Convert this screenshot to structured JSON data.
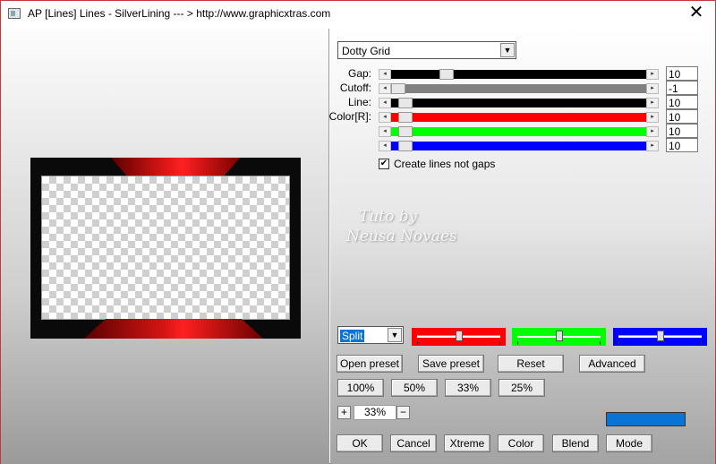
{
  "window": {
    "title": "AP [Lines]  Lines - SilverLining     --- > http://www.graphicxtras.com",
    "close_glyph": "✕"
  },
  "preset_dropdown": {
    "value": "Dotty Grid",
    "arrow": "▼"
  },
  "sliders": [
    {
      "label": "Gap:",
      "value": "10",
      "position": 0.2,
      "track_color": "#000000"
    },
    {
      "label": "Cutoff:",
      "value": "-1",
      "position": 0.0,
      "track_color": "#808080"
    },
    {
      "label": "Line:",
      "value": "10",
      "position": 0.03,
      "track_color": "#000000"
    },
    {
      "label": "Color[R]:",
      "value": "10",
      "position": 0.03,
      "track_color": "#ff0000"
    },
    {
      "label": "",
      "value": "10",
      "position": 0.03,
      "track_color": "#00ff00"
    },
    {
      "label": "",
      "value": "10",
      "position": 0.03,
      "track_color": "#0000ff"
    }
  ],
  "scroll_glyphs": {
    "left": "◂",
    "right": "▸"
  },
  "create_lines": {
    "label": "Create lines not gaps",
    "checked": true,
    "check_glyph": "✔"
  },
  "watermark": {
    "line1": "Tuto by",
    "line2": "Neusa Novaes"
  },
  "split_dropdown": {
    "value": "Split",
    "arrow": "▼"
  },
  "channel_sliders": [
    {
      "color": "#ff0000",
      "position": 0.5
    },
    {
      "color": "#00ff00",
      "position": 0.5
    },
    {
      "color": "#0000ff",
      "position": 0.5
    }
  ],
  "preset_buttons": [
    "Open preset",
    "Save preset",
    "Reset",
    "Advanced"
  ],
  "zoom_buttons": [
    "100%",
    "50%",
    "33%",
    "25%"
  ],
  "zoom_stepper": {
    "plus": "+",
    "value": "33%",
    "minus": "−"
  },
  "accent_swatch": "#0a73d6",
  "bottom_buttons": [
    "OK",
    "Cancel",
    "Xtreme",
    "Color",
    "Blend",
    "Mode"
  ]
}
